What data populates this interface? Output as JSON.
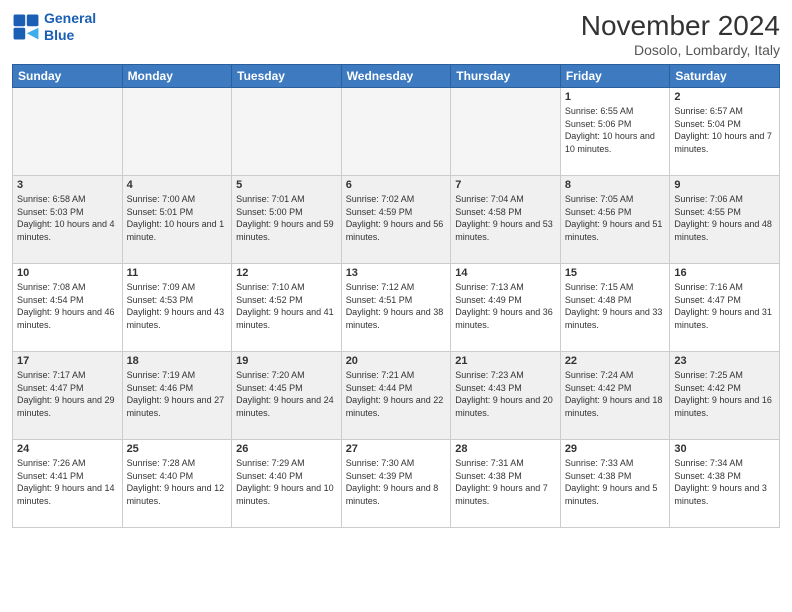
{
  "logo": {
    "line1": "General",
    "line2": "Blue"
  },
  "title": "November 2024",
  "location": "Dosolo, Lombardy, Italy",
  "weekdays": [
    "Sunday",
    "Monday",
    "Tuesday",
    "Wednesday",
    "Thursday",
    "Friday",
    "Saturday"
  ],
  "weeks": [
    [
      {
        "day": "",
        "info": ""
      },
      {
        "day": "",
        "info": ""
      },
      {
        "day": "",
        "info": ""
      },
      {
        "day": "",
        "info": ""
      },
      {
        "day": "",
        "info": ""
      },
      {
        "day": "1",
        "info": "Sunrise: 6:55 AM\nSunset: 5:06 PM\nDaylight: 10 hours and 10 minutes."
      },
      {
        "day": "2",
        "info": "Sunrise: 6:57 AM\nSunset: 5:04 PM\nDaylight: 10 hours and 7 minutes."
      }
    ],
    [
      {
        "day": "3",
        "info": "Sunrise: 6:58 AM\nSunset: 5:03 PM\nDaylight: 10 hours and 4 minutes."
      },
      {
        "day": "4",
        "info": "Sunrise: 7:00 AM\nSunset: 5:01 PM\nDaylight: 10 hours and 1 minute."
      },
      {
        "day": "5",
        "info": "Sunrise: 7:01 AM\nSunset: 5:00 PM\nDaylight: 9 hours and 59 minutes."
      },
      {
        "day": "6",
        "info": "Sunrise: 7:02 AM\nSunset: 4:59 PM\nDaylight: 9 hours and 56 minutes."
      },
      {
        "day": "7",
        "info": "Sunrise: 7:04 AM\nSunset: 4:58 PM\nDaylight: 9 hours and 53 minutes."
      },
      {
        "day": "8",
        "info": "Sunrise: 7:05 AM\nSunset: 4:56 PM\nDaylight: 9 hours and 51 minutes."
      },
      {
        "day": "9",
        "info": "Sunrise: 7:06 AM\nSunset: 4:55 PM\nDaylight: 9 hours and 48 minutes."
      }
    ],
    [
      {
        "day": "10",
        "info": "Sunrise: 7:08 AM\nSunset: 4:54 PM\nDaylight: 9 hours and 46 minutes."
      },
      {
        "day": "11",
        "info": "Sunrise: 7:09 AM\nSunset: 4:53 PM\nDaylight: 9 hours and 43 minutes."
      },
      {
        "day": "12",
        "info": "Sunrise: 7:10 AM\nSunset: 4:52 PM\nDaylight: 9 hours and 41 minutes."
      },
      {
        "day": "13",
        "info": "Sunrise: 7:12 AM\nSunset: 4:51 PM\nDaylight: 9 hours and 38 minutes."
      },
      {
        "day": "14",
        "info": "Sunrise: 7:13 AM\nSunset: 4:49 PM\nDaylight: 9 hours and 36 minutes."
      },
      {
        "day": "15",
        "info": "Sunrise: 7:15 AM\nSunset: 4:48 PM\nDaylight: 9 hours and 33 minutes."
      },
      {
        "day": "16",
        "info": "Sunrise: 7:16 AM\nSunset: 4:47 PM\nDaylight: 9 hours and 31 minutes."
      }
    ],
    [
      {
        "day": "17",
        "info": "Sunrise: 7:17 AM\nSunset: 4:47 PM\nDaylight: 9 hours and 29 minutes."
      },
      {
        "day": "18",
        "info": "Sunrise: 7:19 AM\nSunset: 4:46 PM\nDaylight: 9 hours and 27 minutes."
      },
      {
        "day": "19",
        "info": "Sunrise: 7:20 AM\nSunset: 4:45 PM\nDaylight: 9 hours and 24 minutes."
      },
      {
        "day": "20",
        "info": "Sunrise: 7:21 AM\nSunset: 4:44 PM\nDaylight: 9 hours and 22 minutes."
      },
      {
        "day": "21",
        "info": "Sunrise: 7:23 AM\nSunset: 4:43 PM\nDaylight: 9 hours and 20 minutes."
      },
      {
        "day": "22",
        "info": "Sunrise: 7:24 AM\nSunset: 4:42 PM\nDaylight: 9 hours and 18 minutes."
      },
      {
        "day": "23",
        "info": "Sunrise: 7:25 AM\nSunset: 4:42 PM\nDaylight: 9 hours and 16 minutes."
      }
    ],
    [
      {
        "day": "24",
        "info": "Sunrise: 7:26 AM\nSunset: 4:41 PM\nDaylight: 9 hours and 14 minutes."
      },
      {
        "day": "25",
        "info": "Sunrise: 7:28 AM\nSunset: 4:40 PM\nDaylight: 9 hours and 12 minutes."
      },
      {
        "day": "26",
        "info": "Sunrise: 7:29 AM\nSunset: 4:40 PM\nDaylight: 9 hours and 10 minutes."
      },
      {
        "day": "27",
        "info": "Sunrise: 7:30 AM\nSunset: 4:39 PM\nDaylight: 9 hours and 8 minutes."
      },
      {
        "day": "28",
        "info": "Sunrise: 7:31 AM\nSunset: 4:38 PM\nDaylight: 9 hours and 7 minutes."
      },
      {
        "day": "29",
        "info": "Sunrise: 7:33 AM\nSunset: 4:38 PM\nDaylight: 9 hours and 5 minutes."
      },
      {
        "day": "30",
        "info": "Sunrise: 7:34 AM\nSunset: 4:38 PM\nDaylight: 9 hours and 3 minutes."
      }
    ]
  ]
}
